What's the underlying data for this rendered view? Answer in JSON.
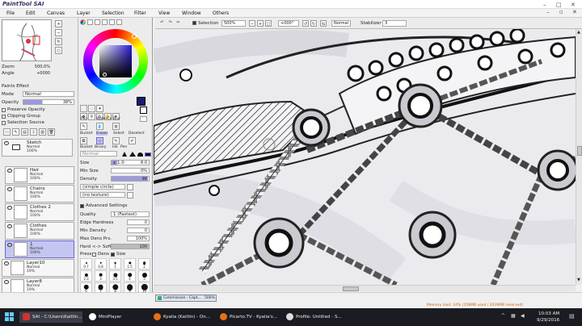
{
  "app": {
    "logo": "PaintTool SAI"
  },
  "menu": [
    "File",
    "Edit",
    "Canvas",
    "Layer",
    "Selection",
    "Filter",
    "View",
    "Window",
    "Others"
  ],
  "toolbar": {
    "selection_label": "Selection",
    "zoom": "500%",
    "angle": "+000°",
    "mode": "Normal",
    "stabilizer_label": "Stabilizer",
    "stabilizer_value": "3"
  },
  "navigator": {
    "zoom_label": "Zoom",
    "zoom_value": "500.0%",
    "angle_label": "Angle",
    "angle_value": "+0000"
  },
  "layer_props": {
    "section": "Paints Effect",
    "mode_label": "Mode",
    "mode_value": "Normal",
    "opacity_label": "Opacity",
    "opacity_value": "38%",
    "preserve_opacity": "Preserve Opacity",
    "clipping_group": "Clipping Group",
    "selection_source": "Selection Source"
  },
  "layers": [
    {
      "name": "Sketch",
      "mode": "Normal",
      "opacity": "100%",
      "folder": true
    },
    {
      "name": "Hair",
      "mode": "Normal",
      "opacity": "100%"
    },
    {
      "name": "Chains",
      "mode": "Normal",
      "opacity": "100%"
    },
    {
      "name": "Clothes 2",
      "mode": "Normal",
      "opacity": "100%"
    },
    {
      "name": "Clothes",
      "mode": "Normal",
      "opacity": "100%"
    },
    {
      "name": "1",
      "mode": "Normal",
      "opacity": "100%",
      "selected": true
    },
    {
      "name": "Layer10",
      "mode": "Normal",
      "opacity": "19%"
    },
    {
      "name": "Layer8",
      "mode": "Normal",
      "opacity": "19%"
    },
    {
      "name": "R5",
      "mode": "",
      "opacity": ""
    }
  ],
  "tools": {
    "row1": [
      "Pen",
      "WaterCo",
      "Blur"
    ],
    "row2": [
      "Bucket",
      "Eraser",
      "Select",
      "Deselect"
    ],
    "row3": [
      "Bucket",
      "Binary",
      "Ink",
      "Pen"
    ],
    "mode_value": "Normal"
  },
  "brush": {
    "size_label": "Size",
    "size_mult": "x 1.0",
    "size_value": "8.0",
    "minsize_label": "Min Size",
    "minsize_value": "0%",
    "density_label": "Density",
    "density_value": "98",
    "shape": "(simple circle)",
    "texture": "(no texture)",
    "adv_label": "Advanced Settings",
    "quality_label": "Quality",
    "quality_value": "1 (Fastest)",
    "edge_label": "Edge Hardness",
    "edge_value": "0",
    "mindens_label": "Min Density",
    "mindens_value": "0",
    "maxdens_label": "Max Dens Prs.",
    "maxdens_value": "100%",
    "hardsoft_label": "Hard <-> Soft",
    "hardsoft_value": "100",
    "press_label": "Press:",
    "press_dens": "Dens",
    "press_size": "Size",
    "presets": [
      "0.7",
      "0.8",
      "1",
      "1.5",
      "2",
      "2.3",
      "3",
      "3.5",
      "4",
      "5",
      "6",
      "7",
      "8",
      "9",
      "10",
      "12",
      "14",
      "16",
      "20",
      "25",
      "30",
      "35",
      "40",
      "50",
      "60",
      "70",
      "80",
      "100",
      "120",
      "150",
      "200",
      "250"
    ]
  },
  "canvas_tab": {
    "title": "Commission - Capt...",
    "zoom": "500%"
  },
  "status": {
    "memory": "Memory load: 24% (358MB used / 2039MB reserved)"
  },
  "taskbar": {
    "items": [
      "SAI - C:\\Users\\Kaitlin...",
      "MiniPlayer",
      "Kyalia (Kaitlin) - On...",
      "Picarto.TV - Kyalia's...",
      "Profile: Untitled - S..."
    ],
    "time": "10:03 AM",
    "date": "9/29/2016"
  },
  "colors": {
    "accent": "#6a6ad4",
    "picked_color": "#1a1a6e",
    "selected_layer": "#c5c5f2"
  }
}
